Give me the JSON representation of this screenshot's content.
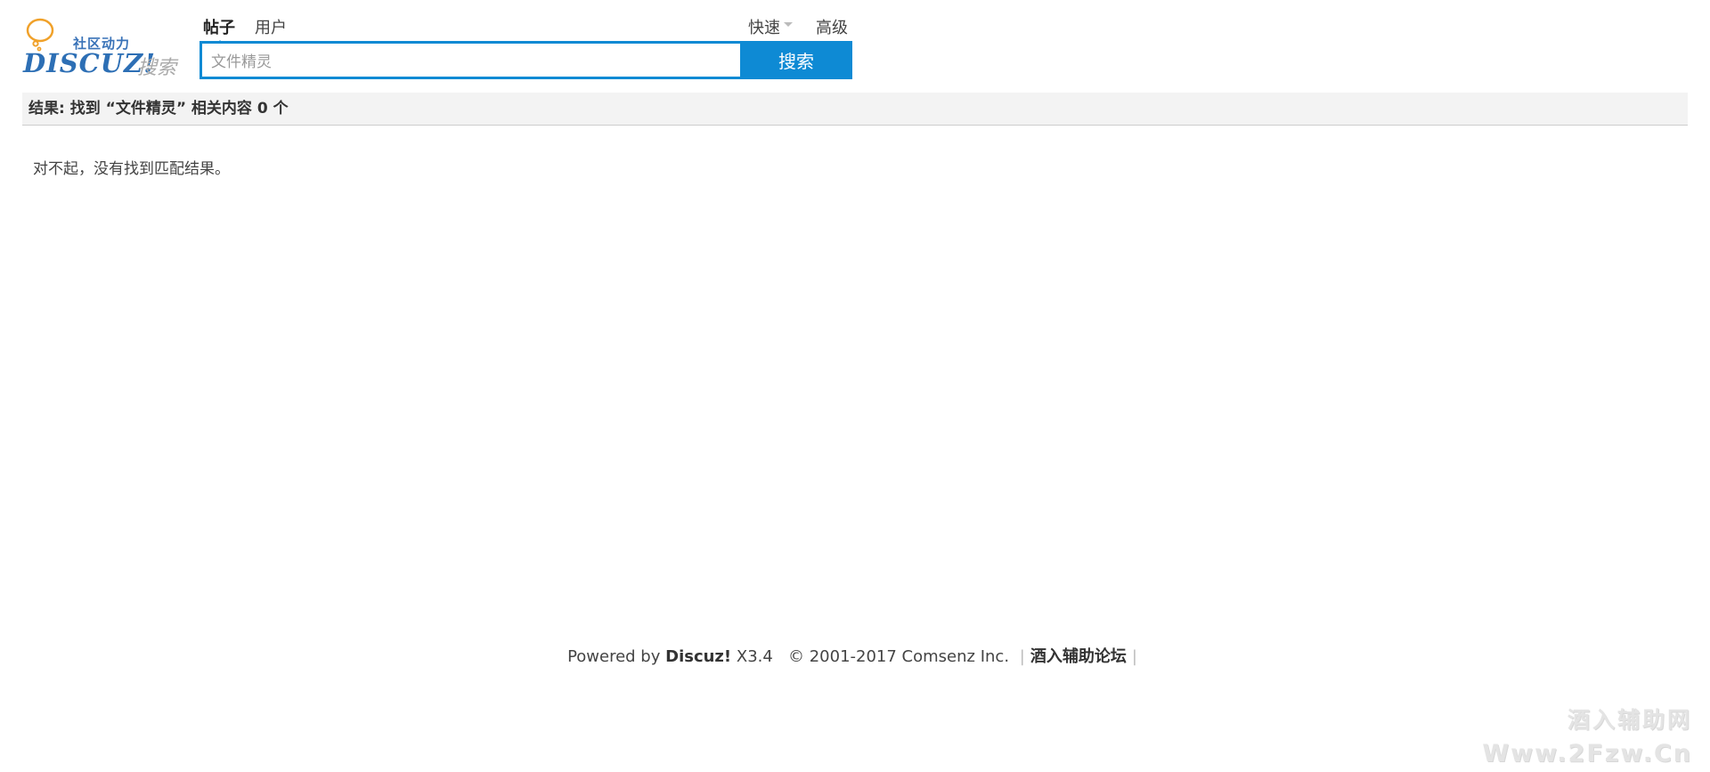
{
  "logo": {
    "slogan": "社区动力",
    "brand": "DISCUZ!",
    "search_word": "搜索"
  },
  "search": {
    "type_tabs": [
      {
        "label": "帖子",
        "active": true
      },
      {
        "label": "用户",
        "active": false
      }
    ],
    "quick_label": "快速",
    "advanced_label": "高级",
    "value": "文件精灵",
    "button_label": "搜索"
  },
  "result": {
    "prefix": "结果: 找到 ",
    "keyword_quoted": "“文件精灵”",
    "suffix": " 相关内容 0 个",
    "empty_message": "对不起，没有找到匹配结果。"
  },
  "footer": {
    "powered_by": "Powered by",
    "product": "Discuz!",
    "version": "X3.4",
    "copyright": "© 2001-2017 Comsenz Inc.",
    "site_link": "酒入辅助论坛"
  },
  "watermark": {
    "line1": "酒入辅助网",
    "line2": "Www.2Fzw.Cn"
  },
  "colors": {
    "accent": "#0e8ad4",
    "result_bar_bg": "#f3f3f3",
    "logo_blue": "#2d6fb5",
    "logo_orange": "#f0a12a"
  }
}
